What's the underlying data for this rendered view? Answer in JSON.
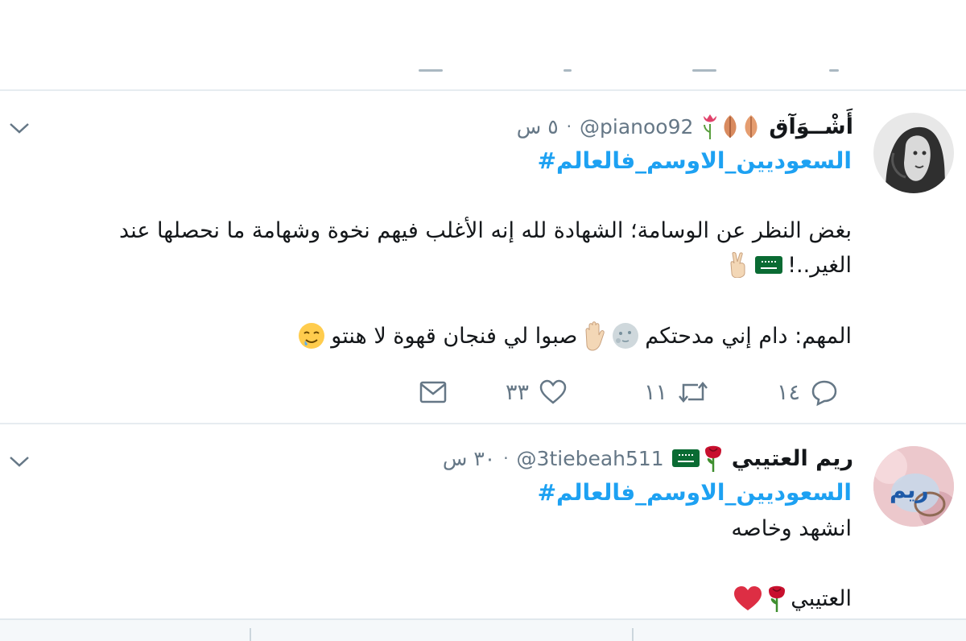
{
  "tweets": [
    {
      "display_name": "أَشْــوَآق",
      "handle": "@pianoo92",
      "time": "٥ س",
      "separator": "·",
      "hashtag": "#السعوديين_الاوسم_فالعالم",
      "lines": [
        "بغض النظر عن الوسامة؛ الشهادة لله إنه الأغلب فيهم نخوة وشهامة ما نحصلها عند",
        "الغير..!",
        "المهم: دام إني مدحتكم",
        "صبوا لي فنجان قهوة لا هنتو"
      ],
      "replies": "١٤",
      "retweets": "١١",
      "likes": "٣٣",
      "icons": [
        "leaf-icon",
        "tulip-icon",
        "saudi-flag-icon",
        "victory-hand-icon",
        "moon-face-icon",
        "raised-hand-icon",
        "drooling-face-icon"
      ]
    },
    {
      "display_name": "ريم العتيبي",
      "handle": "@3tiebeah511",
      "time": "٣٠ س",
      "separator": "·",
      "hashtag": "#السعوديين_الاوسم_فالعالم",
      "avatar_text": "ريم",
      "lines": [
        "انشهد وخاصه",
        "العتيبي"
      ],
      "icons": [
        "saudi-flag-icon",
        "rose-icon",
        "red-heart-icon"
      ]
    }
  ],
  "colors": {
    "hashtag": "#1da1f2",
    "secondary_text": "#657786",
    "primary_text": "#14171a",
    "separator": "#e6ecf0"
  }
}
